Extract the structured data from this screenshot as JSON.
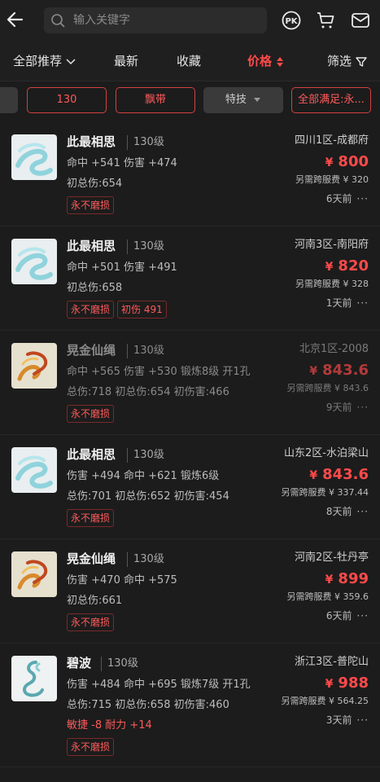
{
  "search": {
    "placeholder": "输入关键字"
  },
  "sort": {
    "recommend": "全部推荐",
    "newest": "最新",
    "favorites": "收藏",
    "price": "价格",
    "filter": "筛选"
  },
  "chips": [
    "",
    "130",
    "飘带",
    "特技",
    "全部满足:永..."
  ],
  "colors": {
    "accent": "#ff4a4a"
  },
  "items": [
    {
      "name": "此最相思",
      "level": "130级",
      "lines": [
        "命中 +541 伤害 +474",
        "初总伤:654"
      ],
      "tags": [
        "永不磨损"
      ],
      "server": "四川1区-成都府",
      "currency": "¥",
      "price": "800",
      "fee": "另需跨服费 ¥ 320",
      "time": "6天前",
      "more": "···",
      "icon": "ribbon-cyan-icon",
      "dim": false
    },
    {
      "name": "此最相思",
      "level": "130级",
      "lines": [
        "命中 +501 伤害 +491",
        "初总伤:658"
      ],
      "tags": [
        "永不磨损",
        "初伤 491"
      ],
      "server": "河南3区-南阳府",
      "currency": "¥",
      "price": "820",
      "fee": "另需跨服费 ¥ 328",
      "time": "1天前",
      "more": "···",
      "icon": "ribbon-cyan-icon",
      "dim": false
    },
    {
      "name": "晃金仙绳",
      "level": "130级",
      "lines": [
        "命中 +565 伤害 +530 锻炼8级 开1孔",
        "总伤:718 初总伤:654 初伤害:466"
      ],
      "tags": [
        "永不磨损"
      ],
      "server": "北京1区-2008",
      "currency": "¥",
      "price": "843.6",
      "fee": "另需跨服费 ¥ 843.6",
      "time": "9天前",
      "more": "···",
      "icon": "ribbon-gold-icon",
      "dim": true
    },
    {
      "name": "此最相思",
      "level": "130级",
      "lines": [
        "伤害 +494 命中 +621 锻炼6级",
        "总伤:701 初总伤:652 初伤害:454"
      ],
      "tags": [
        "永不磨损"
      ],
      "server": "山东2区-水泊梁山",
      "currency": "¥",
      "price": "843.6",
      "fee": "另需跨服费 ¥ 337.44",
      "time": "8天前",
      "more": "···",
      "icon": "ribbon-cyan-icon",
      "dim": false
    },
    {
      "name": "晃金仙绳",
      "level": "130级",
      "lines": [
        "伤害 +470 命中 +575",
        "初总伤:661"
      ],
      "tags": [
        "永不磨损"
      ],
      "server": "河南2区-牡丹亭",
      "currency": "¥",
      "price": "899",
      "fee": "另需跨服费 ¥ 359.6",
      "time": "6天前",
      "more": "···",
      "icon": "ribbon-gold-icon",
      "dim": false
    },
    {
      "name": "碧波",
      "level": "130级",
      "lines": [
        "伤害 +484 命中 +695 锻炼7级 开1孔",
        "总伤:715 初总伤:658 初伤害:460"
      ],
      "redline": "敏捷 -8 耐力 +14",
      "tags": [
        "永不磨损"
      ],
      "server": "浙江3区-普陀山",
      "currency": "¥",
      "price": "988",
      "fee": "另需跨服费 ¥ 564.25",
      "time": "3天前",
      "more": "···",
      "icon": "ribbon-teal-icon",
      "dim": false
    }
  ]
}
